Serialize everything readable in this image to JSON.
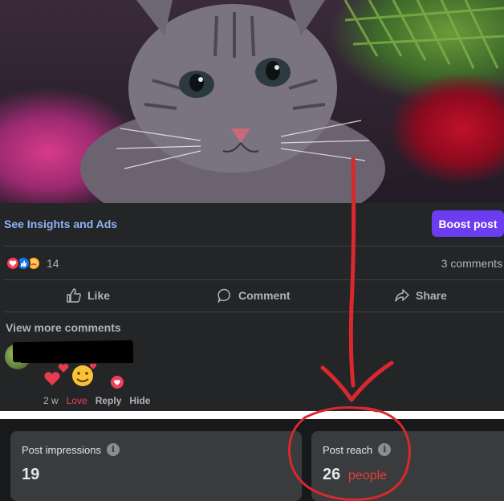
{
  "post": {
    "insights_link": "See Insights and Ads",
    "boost_button": "Boost post",
    "reaction_count": "14",
    "comments_count": "3 comments",
    "actions": {
      "like": "Like",
      "comment": "Comment",
      "share": "Share"
    }
  },
  "comments": {
    "view_more": "View more comments",
    "first": {
      "time": "2 w",
      "love": "Love",
      "reply": "Reply",
      "hide": "Hide"
    }
  },
  "insights": {
    "impressions": {
      "label": "Post impressions",
      "value": "19"
    },
    "reach": {
      "label": "Post reach",
      "value": "26",
      "annotation": "people"
    }
  },
  "colors": {
    "boost": "#6b3cf0",
    "link": "#8fb4f8",
    "annotation_red": "#e8413a",
    "love": "#f33e58"
  },
  "icons": [
    "like-icon",
    "comment-icon",
    "share-icon",
    "info-icon",
    "love-reaction-icon",
    "like-reaction-icon",
    "care-reaction-icon"
  ]
}
